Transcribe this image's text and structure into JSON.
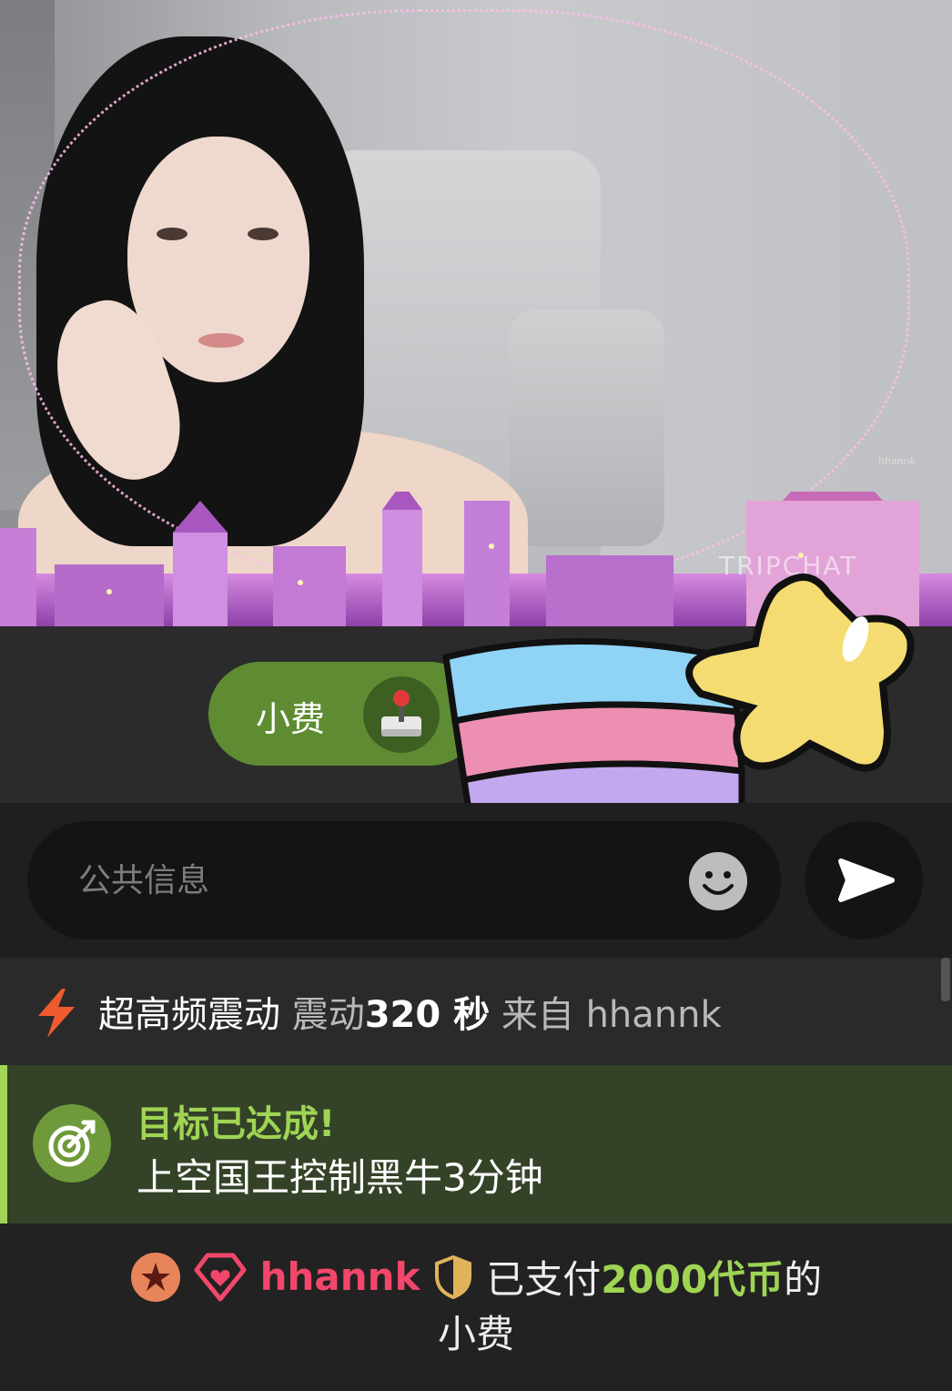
{
  "video": {
    "watermark": "TRIPCHAT",
    "corner_tag": "hhannk"
  },
  "tip": {
    "label": "小费"
  },
  "chat_input": {
    "placeholder": "公共信息"
  },
  "messages": {
    "vibration": {
      "title": "超高频震动",
      "prefix": "震动",
      "duration": "320 秒",
      "from_label": "来自",
      "user": "hhannk"
    },
    "goal": {
      "title": "目标已达成!",
      "text": "上空国王控制黑牛3分钟"
    },
    "tip": {
      "user": "hhannk",
      "paid_label": "已支付",
      "amount": "2000代币",
      "suffix": "的",
      "line2": "小费"
    }
  },
  "colors": {
    "tip_pill": "#5f8c33",
    "goal_accent": "#9fd454",
    "username": "#f2476b",
    "bolt": "#ef5a2f"
  },
  "icons": [
    "joystick-icon",
    "shooting-star-sticker",
    "smiley-icon",
    "send-icon",
    "lightning-bolt-icon",
    "target-icon",
    "star-badge-icon",
    "diamond-heart-icon",
    "shield-icon"
  ]
}
